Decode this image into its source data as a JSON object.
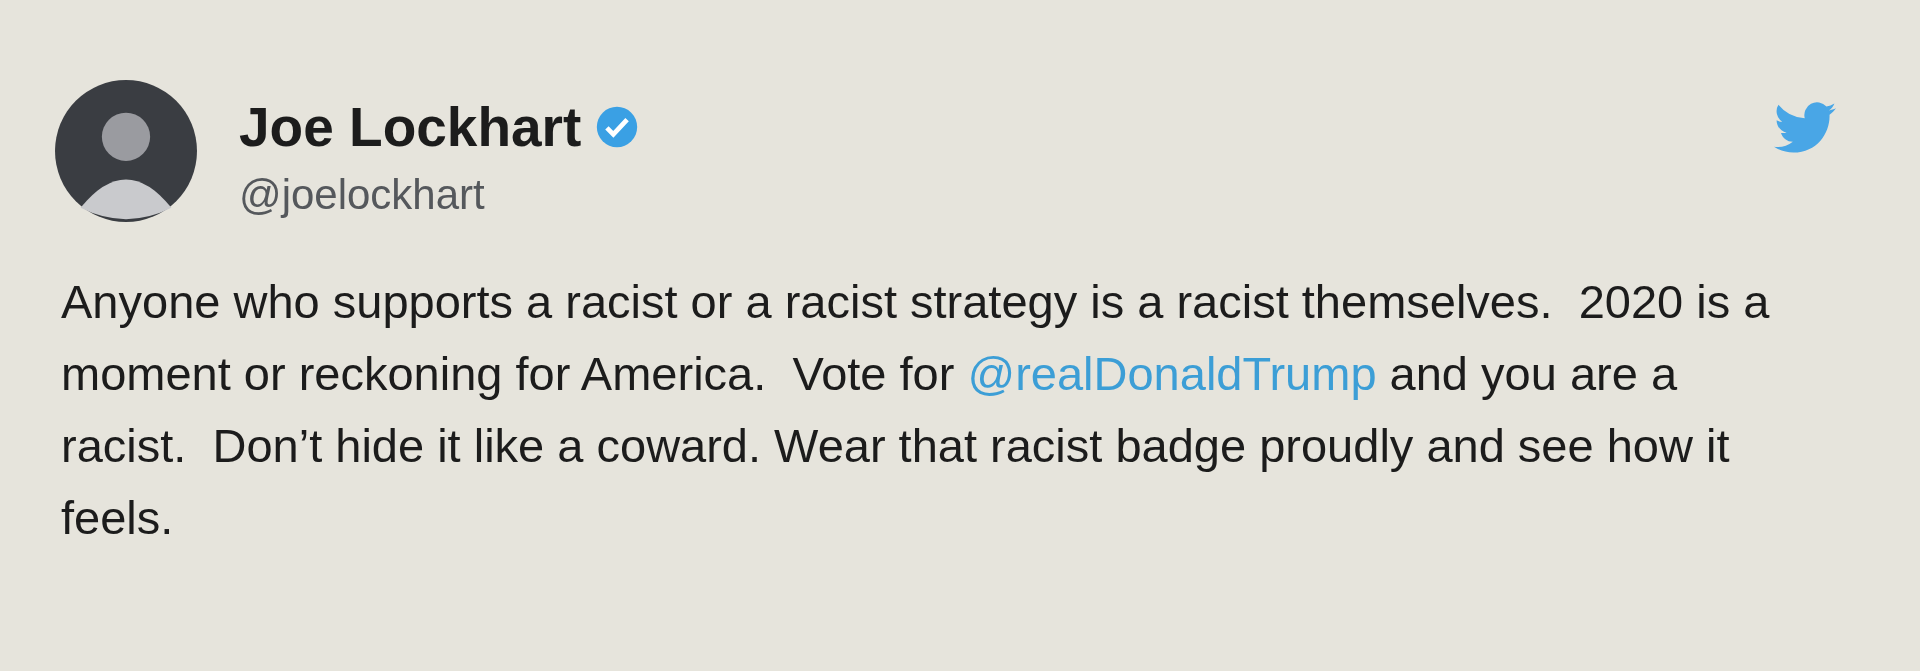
{
  "tweet": {
    "author": {
      "name": "Joe Lockhart",
      "verified": true,
      "handle": "@joelockhart"
    },
    "body": [
      {
        "kind": "text",
        "text": "Anyone who supports a racist or a racist strategy is a racist themselves.  2020 is a moment or reckoning for America.  Vote for "
      },
      {
        "kind": "mention",
        "text": "@realDonaldTrump"
      },
      {
        "kind": "text",
        "text": " and you are a racist.  Don’t hide it like a coward. Wear that racist badge proudly and see how it feels."
      }
    ]
  }
}
